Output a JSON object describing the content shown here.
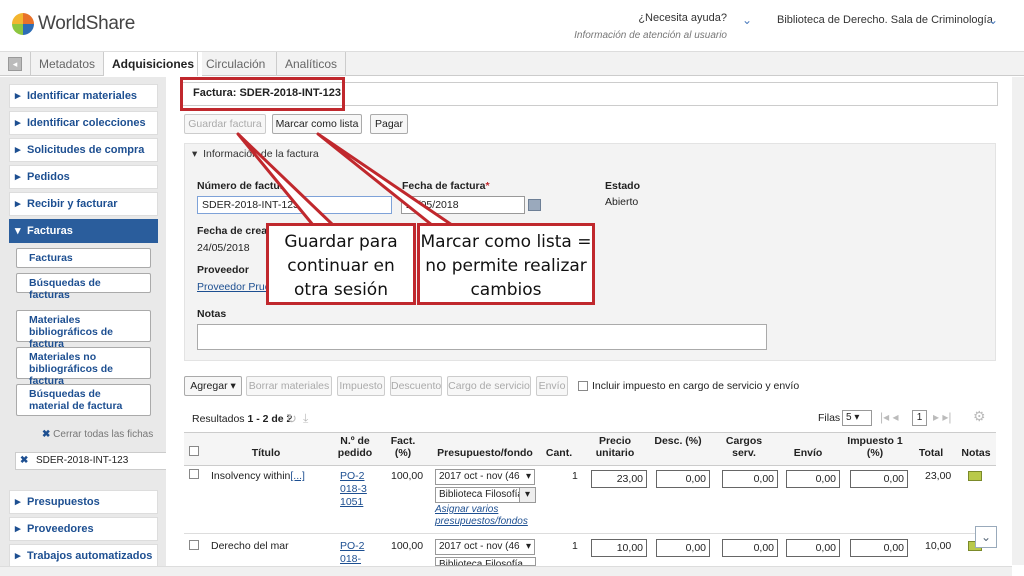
{
  "header": {
    "logo_text": "WorldShare",
    "help_title": "¿Necesita ayuda?",
    "help_subtitle": "Información de atención al usuario",
    "library": "Biblioteca de Derecho. Sala de Criminología"
  },
  "tabs": [
    "Metadatos",
    "Adquisiciones",
    "Circulación",
    "Analíticos"
  ],
  "sidebar": {
    "items": [
      "Identificar materiales",
      "Identificar colecciones",
      "Solicitudes de compra",
      "Pedidos",
      "Recibir y facturar",
      "Facturas"
    ],
    "sub_buttons": [
      "Facturas",
      "Búsquedas de facturas",
      "Materiales bibliográficos de factura",
      "Materiales no bibliográficos de factura",
      "Búsquedas de material de factura"
    ],
    "clear_all": "Cerrar todas las fichas",
    "chip": "SDER-2018-INT-123",
    "bottom_items": [
      "Presupuestos",
      "Proveedores",
      "Trabajos automatizados"
    ]
  },
  "invoice": {
    "title": "Factura: SDER-2018-INT-123",
    "buttons": {
      "save": "Guardar factura",
      "mark": "Marcar como lista",
      "pay": "Pagar"
    },
    "section": "Información de la factura",
    "number_label": "Número de factura",
    "number_value": "SDER-2018-INT-123",
    "date_label": "Fecha de factura",
    "date_value": "24/05/2018",
    "status_label": "Estado",
    "status_value": "Abierto",
    "created_label": "Fecha de creación",
    "created_value": "24/05/2018",
    "vendor_label": "Proveedor",
    "vendor_value": "Proveedor Prueba",
    "notes_label": "Notas"
  },
  "toolbar": {
    "add": "Agregar",
    "delete": "Borrar materiales",
    "tax": "Impuesto",
    "discount": "Descuento",
    "service": "Cargo de servicio",
    "shipping": "Envío",
    "include_tax": "Incluir impuesto en cargo de servicio y envío"
  },
  "results": {
    "prefix": "Resultados",
    "range": "1 - 2",
    "of": "de 2",
    "rows_label": "Filas",
    "rows_value": "5",
    "page": "1"
  },
  "table": {
    "headers": [
      "Título",
      "N.º de pedido",
      "Fact. (%)",
      "Presupuesto/fondo",
      "Cant.",
      "Precio unitario",
      "Desc. (%)",
      "Cargos serv.",
      "Envío",
      "Impuesto 1 (%)",
      "Total",
      "Notas"
    ],
    "rows": [
      {
        "title": "Insolvency within",
        "more": "[...]",
        "order": "PO-2018-31051",
        "fact": "100,00",
        "budget": "2017 oct - nov (46",
        "fund": "Biblioteca Filosofía",
        "assign": "Asignar varios presupuestos/fondos",
        "qty": "1",
        "price": "23,00",
        "disc": "0,00",
        "serv": "0,00",
        "ship": "0,00",
        "tax": "0,00",
        "total": "23,00"
      },
      {
        "title": "Derecho del mar",
        "order": "PO-2018-",
        "fact": "100,00",
        "budget": "2017 oct - nov (46",
        "fund": "Biblioteca Filosofía",
        "qty": "1",
        "price": "10,00",
        "disc": "0,00",
        "serv": "0,00",
        "ship": "0,00",
        "tax": "0,00",
        "total": "10,00"
      }
    ]
  },
  "callouts": {
    "save": "Guardar para continuar en otra sesión",
    "mark": "Marcar como lista = no permite realizar cambios"
  },
  "colors": {
    "annotation_red": "#c0282d",
    "nav_blue": "#2a5d9c",
    "link_blue": "#1d4f91"
  }
}
